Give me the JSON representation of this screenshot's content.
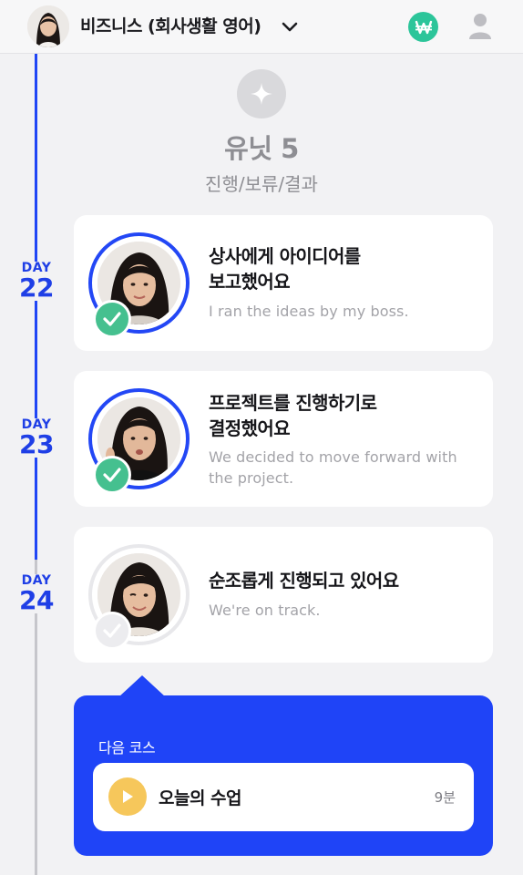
{
  "header": {
    "course_title": "비즈니스 (회사생활 영어)",
    "icons": {
      "avatar": "instructor-avatar",
      "dropdown": "chevron-down-icon",
      "coin": "won-coin-icon",
      "profile": "user-icon"
    },
    "colors": {
      "coin_bg": "#2cc59a"
    }
  },
  "unit": {
    "icon": "sparkle-icon",
    "title": "유닛 5",
    "subtitle": "진행/보류/결과"
  },
  "days": [
    {
      "label": "DAY",
      "number": "22"
    },
    {
      "label": "DAY",
      "number": "23"
    },
    {
      "label": "DAY",
      "number": "24"
    }
  ],
  "lessons": [
    {
      "title_line1": "상사에게 아이디어를",
      "title_line2": "보고했어요",
      "subtitle": "I ran the ideas by my boss.",
      "status": "completed"
    },
    {
      "title_line1": "프로젝트를 진행하기로",
      "title_line2": "결정했어요",
      "subtitle": "We decided to move forward with the project.",
      "status": "completed"
    },
    {
      "title_line1": "순조롭게 진행되고 있어요",
      "title_line2": "",
      "subtitle": "We're on track.",
      "status": "pending"
    }
  ],
  "next_course": {
    "label": "다음 코스",
    "title": "오늘의 수업",
    "duration": "9분",
    "icon": "play-icon"
  },
  "colors": {
    "accent_blue": "#1f44f7",
    "complete_green": "#45c08f",
    "play_yellow": "#f6c75b",
    "timeline_done": "#2046f5",
    "timeline_todo": "#c6c6cb"
  }
}
